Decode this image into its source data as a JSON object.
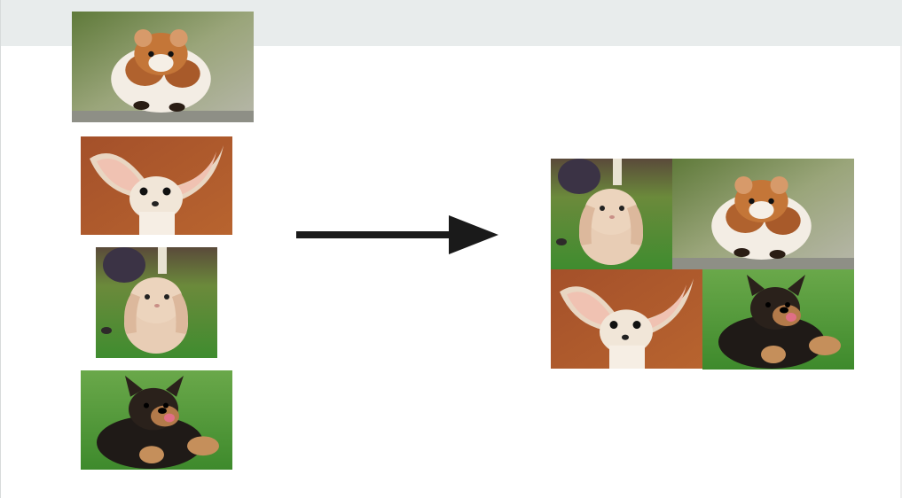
{
  "slide": {
    "title": "",
    "band_color": "#e8ecec"
  },
  "inputs": [
    {
      "animal": "hamster"
    },
    {
      "animal": "fennec-fox"
    },
    {
      "animal": "lop-rabbit"
    },
    {
      "animal": "german-shepherd-puppy"
    }
  ],
  "arrow": {
    "direction": "right",
    "color": "#1a1a1a"
  },
  "output": {
    "layout": "2x2 mosaic",
    "tiles": [
      {
        "animal": "lop-rabbit"
      },
      {
        "animal": "hamster"
      },
      {
        "animal": "fennec-fox"
      },
      {
        "animal": "german-shepherd-puppy"
      }
    ]
  }
}
